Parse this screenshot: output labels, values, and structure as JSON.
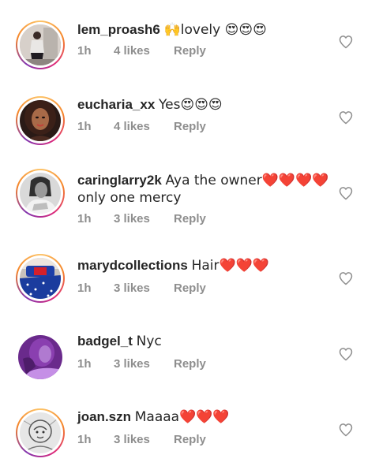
{
  "colors": {
    "text": "#262626",
    "meta": "#8e8e8e",
    "heart_emoji": "#e0102a",
    "ring_gradient": [
      "#fdc468",
      "#f58529",
      "#dd2a7b",
      "#8134af"
    ]
  },
  "comments": [
    {
      "username": "lem_proash6",
      "text": "🙌lovely 😍😍😍",
      "time": "1h",
      "likes": "4 likes",
      "reply": "Reply",
      "avatar": "avatar-photo-person-standing",
      "ring": true
    },
    {
      "username": "eucharia_xx",
      "text": "Yes😍😍😍",
      "time": "1h",
      "likes": "4 likes",
      "reply": "Reply",
      "avatar": "avatar-photo-woman-portrait",
      "ring": true
    },
    {
      "username": "caringlarry2k",
      "text": "Aya the owner❤️❤️❤️❤️ only one mercy",
      "time": "1h",
      "likes": "3 likes",
      "reply": "Reply",
      "avatar": "avatar-photo-grayscale-portrait",
      "ring": true
    },
    {
      "username": "marydcollections",
      "text": "Hair❤️❤️❤️",
      "time": "1h",
      "likes": "3 likes",
      "reply": "Reply",
      "avatar": "avatar-photo-bedding",
      "ring": true
    },
    {
      "username": "badgel_t",
      "text": "Nyc",
      "time": "1h",
      "likes": "3 likes",
      "reply": "Reply",
      "avatar": "avatar-photo-purple",
      "ring": false
    },
    {
      "username": "joan.szn",
      "text": "Maaaa❤️❤️❤️",
      "time": "1h",
      "likes": "3 likes",
      "reply": "Reply",
      "avatar": "avatar-photo-sketch",
      "ring": true
    }
  ]
}
